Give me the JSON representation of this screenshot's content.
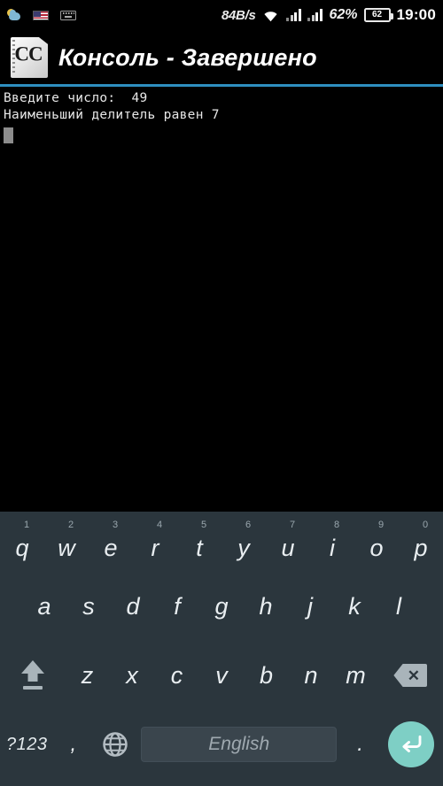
{
  "statusbar": {
    "icons_left": [
      "weather-cloud-icon",
      "us-flag-icon",
      "keyboard-indicator-icon"
    ],
    "network_speed": "84B/s",
    "wifi": "wifi-icon",
    "signal1": "signal-bars-icon",
    "signal2": "signal-bars-icon",
    "battery_percent": "62%",
    "battery_level_label": "62",
    "time": "19:00"
  },
  "titlebar": {
    "app_icon_text": "CC",
    "title": "Консоль - Завершено"
  },
  "console": {
    "lines": [
      "Введите число:  49",
      "Наименьший делитель равен 7"
    ],
    "cursor_visible": true
  },
  "keyboard": {
    "language": "English",
    "row1": [
      {
        "letter": "q",
        "num": "1"
      },
      {
        "letter": "w",
        "num": "2"
      },
      {
        "letter": "e",
        "num": "3"
      },
      {
        "letter": "r",
        "num": "4"
      },
      {
        "letter": "t",
        "num": "5"
      },
      {
        "letter": "y",
        "num": "6"
      },
      {
        "letter": "u",
        "num": "7"
      },
      {
        "letter": "i",
        "num": "8"
      },
      {
        "letter": "o",
        "num": "9"
      },
      {
        "letter": "p",
        "num": "0"
      }
    ],
    "row2": [
      {
        "letter": "a"
      },
      {
        "letter": "s"
      },
      {
        "letter": "d"
      },
      {
        "letter": "f"
      },
      {
        "letter": "g"
      },
      {
        "letter": "h"
      },
      {
        "letter": "j"
      },
      {
        "letter": "k"
      },
      {
        "letter": "l"
      }
    ],
    "row3": [
      {
        "letter": "z"
      },
      {
        "letter": "x"
      },
      {
        "letter": "c"
      },
      {
        "letter": "v"
      },
      {
        "letter": "b"
      },
      {
        "letter": "n"
      },
      {
        "letter": "m"
      }
    ],
    "shift_label": "shift-icon",
    "backspace_label": "✕",
    "symbols_key": "?123",
    "comma_key": ",",
    "period_key": ".",
    "globe_key": "globe-icon",
    "enter_key": "enter-icon"
  },
  "colors": {
    "accent_rule": "#2e8fc0",
    "keyboard_bg": "#2b363d",
    "spacebar_bg": "#3a454d",
    "enter_bg": "#7ecfc5",
    "console_bg": "#000000",
    "console_text": "#e8e8e8"
  }
}
